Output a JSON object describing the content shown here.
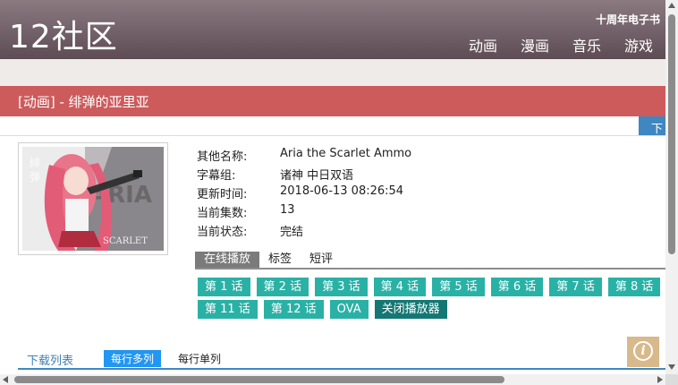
{
  "header": {
    "logo": "12社区",
    "anniversary_link": "十周年电子书",
    "nav": [
      "动画",
      "漫画",
      "音乐",
      "游戏"
    ]
  },
  "title_bar": {
    "title": "[动画] - 绯弹的亚里亚"
  },
  "download_tab_label": "下",
  "cover": {
    "alt": "绯弹的亚里亚 cover art",
    "icon": "anime-cover-image"
  },
  "info": {
    "rows": [
      {
        "label": "其他名称:",
        "value": "Aria the Scarlet Ammo"
      },
      {
        "label": "字幕组:",
        "value": "诸神 中日双语"
      },
      {
        "label": "更新时间:",
        "value": "2018-06-13 08:26:54"
      },
      {
        "label": "当前集数:",
        "value": "13"
      },
      {
        "label": "当前状态:",
        "value": "完结"
      }
    ]
  },
  "tabs": [
    "在线播放",
    "标签",
    "短评"
  ],
  "episodes": {
    "row1": [
      "第 1 话",
      "第 2 话",
      "第 3 话",
      "第 4 话",
      "第 5 话",
      "第 6 话",
      "第 7 话",
      "第 8 话"
    ],
    "row2": [
      "第 11 话",
      "第 12 话",
      "OVA"
    ],
    "close_player": "关闭播放器"
  },
  "download_list": {
    "title": "下载列表",
    "multi_per_row": "每行多列",
    "single_per_row": "每行单列"
  },
  "info_button_icon": "info-icon",
  "colors": {
    "header": "#6e5d64",
    "title_bar": "#cd5b5c",
    "episode_button": "#2ab1a6",
    "close_button": "#137874",
    "accent_blue": "#3f87c0"
  }
}
